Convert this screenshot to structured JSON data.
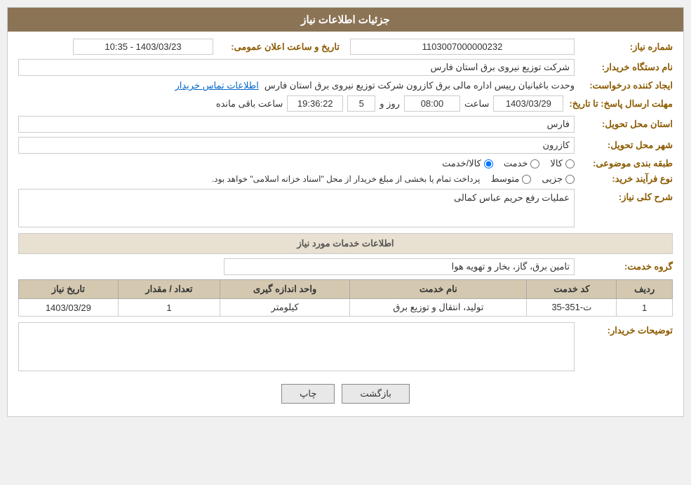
{
  "header": {
    "title": "جزئیات اطلاعات نیاز"
  },
  "form": {
    "need_number_label": "شماره نیاز:",
    "need_number_value": "1103007000000232",
    "announcement_date_label": "تاریخ و ساعت اعلان عمومی:",
    "announcement_date_value": "1403/03/23 - 10:35",
    "buyer_name_label": "نام دستگاه خریدار:",
    "buyer_name_value": "شرکت توزیع نیروی برق استان فارس",
    "creator_label": "ایجاد کننده درخواست:",
    "creator_value": "وحدت باغبانیان رییس اداره مالی برق کازرون شرکت توزیع نیروی برق استان فارس",
    "contact_link": "اطلاعات تماس خریدار",
    "response_deadline_label": "مهلت ارسال پاسخ: تا تاریخ:",
    "response_date_value": "1403/03/29",
    "response_time_label": "ساعت",
    "response_time_value": "08:00",
    "response_days_label": "روز و",
    "response_days_value": "5",
    "response_remaining_label": "ساعت باقی مانده",
    "response_remaining_value": "19:36:22",
    "delivery_province_label": "استان محل تحویل:",
    "delivery_province_value": "فارس",
    "delivery_city_label": "شهر محل تحویل:",
    "delivery_city_value": "کازرون",
    "category_label": "طبقه بندی موضوعی:",
    "category_options": [
      "کالا",
      "خدمت",
      "کالا/خدمت"
    ],
    "category_selected": "کالا/خدمت",
    "process_type_label": "نوع فرآیند خرید:",
    "process_options": [
      "جزیی",
      "متوسط"
    ],
    "process_note": "پرداخت تمام یا بخشی از مبلغ خریدار از محل \"اسناد خزانه اسلامی\" خواهد بود.",
    "general_description_label": "شرح کلی نیاز:",
    "general_description_value": "عملیات رفع حریم عباس کمالی",
    "services_section_title": "اطلاعات خدمات مورد نیاز",
    "service_group_label": "گروه خدمت:",
    "service_group_value": "تامین برق، گاز، بخار و تهویه هوا",
    "table": {
      "columns": [
        "ردیف",
        "کد خدمت",
        "نام خدمت",
        "واحد اندازه گیری",
        "تعداد / مقدار",
        "تاریخ نیاز"
      ],
      "rows": [
        {
          "row": "1",
          "service_code": "ت-351-35",
          "service_name": "تولید، انتقال و توزیع برق",
          "unit": "کیلومتر",
          "quantity": "1",
          "date": "1403/03/29"
        }
      ]
    },
    "buyer_notes_label": "توضیحات خریدار:",
    "buyer_notes_value": ""
  },
  "buttons": {
    "print_label": "چاپ",
    "back_label": "بازگشت"
  }
}
